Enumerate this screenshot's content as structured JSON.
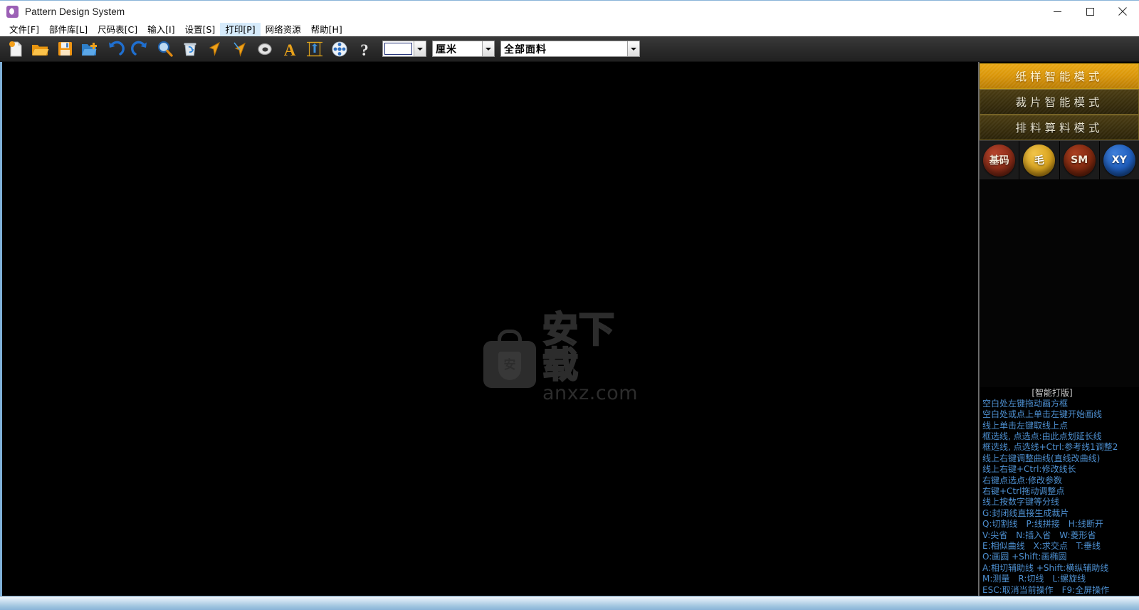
{
  "window": {
    "title": "Pattern Design System",
    "app_icon": "app-logo-icon",
    "minimize": "minimize-icon",
    "maximize": "maximize-icon",
    "close": "close-icon"
  },
  "menubar": {
    "items": [
      {
        "label": "文件[F]",
        "active": false
      },
      {
        "label": "部件库[L]",
        "active": false
      },
      {
        "label": "尺码表[C]",
        "active": false
      },
      {
        "label": "输入[I]",
        "active": false
      },
      {
        "label": "设置[S]",
        "active": false
      },
      {
        "label": "打印[P]",
        "active": true
      },
      {
        "label": "网络资源",
        "active": false
      },
      {
        "label": "帮助[H]",
        "active": false
      }
    ]
  },
  "toolbar": {
    "buttons": [
      {
        "name": "new-file-icon",
        "title": "新建"
      },
      {
        "name": "open-folder-icon",
        "title": "打开"
      },
      {
        "name": "save-icon",
        "title": "保存"
      },
      {
        "name": "new-folder-icon",
        "title": "另存"
      },
      {
        "name": "undo-icon",
        "title": "撤销"
      },
      {
        "name": "redo-icon",
        "title": "重做"
      },
      {
        "name": "zoom-icon",
        "title": "缩放"
      },
      {
        "name": "trash-icon",
        "title": "删除"
      },
      {
        "name": "cursor-orange-icon",
        "title": "选择"
      },
      {
        "name": "cursor-blue-icon",
        "title": "点选"
      },
      {
        "name": "spiral-icon",
        "title": "螺旋"
      },
      {
        "name": "text-tool-icon",
        "title": "文字"
      },
      {
        "name": "grade-ruler-icon",
        "title": "放码"
      },
      {
        "name": "film-reel-icon",
        "title": "素材"
      },
      {
        "name": "help-question-icon",
        "title": "帮助"
      }
    ],
    "combo_color": {
      "value": "",
      "label": "颜色"
    },
    "combo_unit": {
      "value": "厘米"
    },
    "combo_fabric": {
      "value": "全部面料"
    }
  },
  "canvas": {
    "watermark": {
      "logo_char": "安",
      "cn_text": "安下载",
      "url_text": "anxz.com"
    }
  },
  "sidebar": {
    "modes": [
      {
        "label": "纸样智能模式",
        "active": true
      },
      {
        "label": "裁片智能模式",
        "active": false
      },
      {
        "label": "排料算料模式",
        "active": false
      }
    ],
    "circles": [
      {
        "label": "基码",
        "color": "#8d2d18",
        "style": "red"
      },
      {
        "label": "毛",
        "color": "#dba51f",
        "style": "gold"
      },
      {
        "label": "SM",
        "color": "#82290f",
        "style": "red2"
      },
      {
        "label": "XY",
        "color": "#1f5fc0",
        "style": "blue"
      }
    ],
    "help": {
      "title": "[智能打版]",
      "lines": [
        "空白处左键拖动画方框",
        "空白处或点上单击左键开始画线",
        "线上单击左键取线上点",
        "框选线, 点选点:由此点划延长线",
        "框选线, 点选线+Ctrl:参考线1调整2",
        "线上右键调整曲线(直线改曲线)",
        "线上右键+Ctrl:修改线长",
        "右键点选点:修改参数",
        "右键+Ctrl拖动调整点",
        "线上按数字键等分线",
        "G:封闭线直接生成裁片",
        "Q:切割线　P:线拼接　H:线断开",
        "V:尖省　N:插入省　W:菱形省",
        "E:相似曲线　X:求交点　T:垂线",
        "O:画圆 +Shift:画椭圆",
        "A:相切辅助线 +Shift:横纵辅助线",
        "M:测量　R:切线　L:螺旋线",
        "ESC:取消当前操作　F9:全屏操作"
      ]
    }
  },
  "statusbar": {
    "text": ""
  }
}
